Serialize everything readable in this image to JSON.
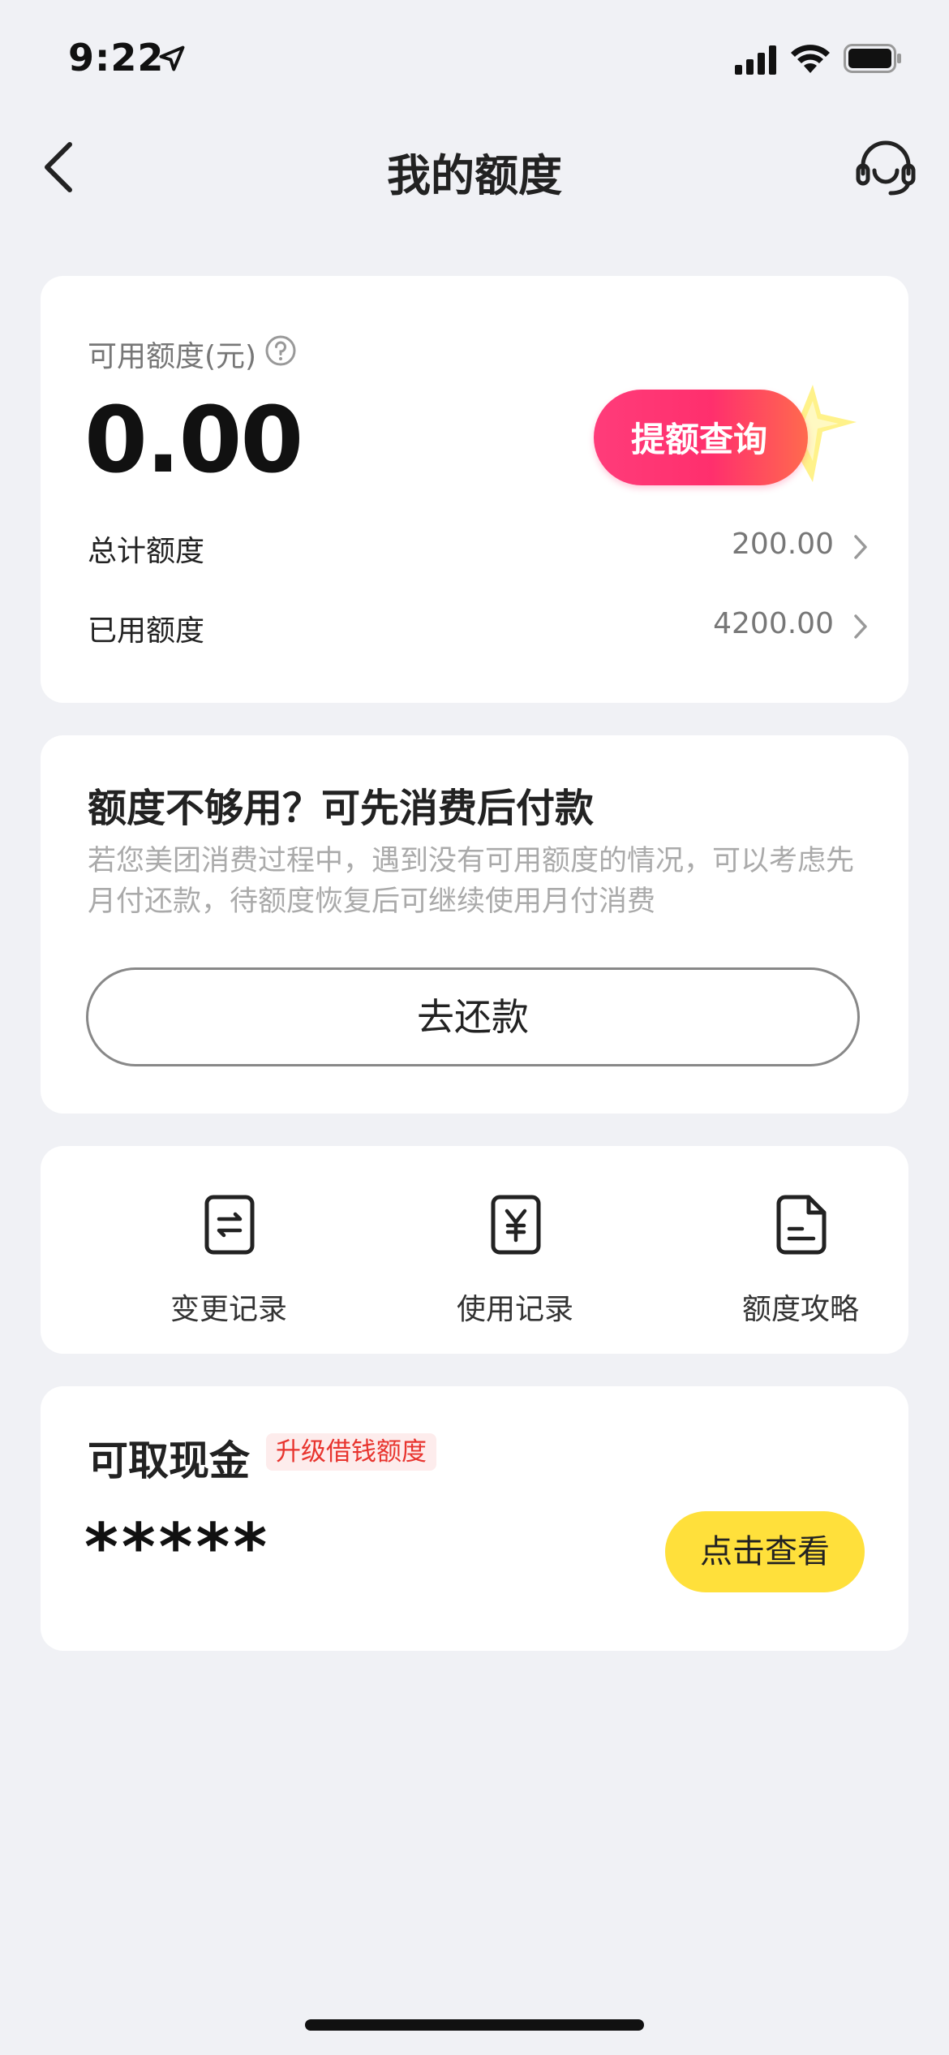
{
  "status_bar": {
    "time": "9:22",
    "icons": [
      "location-arrow-icon",
      "signal-icon",
      "wifi-icon",
      "battery-icon"
    ]
  },
  "nav": {
    "title": "我的额度",
    "left_icon": "chevron-left-icon",
    "right_icon": "headset-icon"
  },
  "limit_card": {
    "available_label": "可用额度(元)",
    "available_amount": "0.00",
    "raise_button": "提额查询",
    "rows": [
      {
        "label": "总计额度",
        "value": "200.00"
      },
      {
        "label": "已用额度",
        "value": "4200.00"
      }
    ]
  },
  "pay_later_card": {
    "title": "额度不够用？可先消费后付款",
    "description": "若您美团消费过程中，遇到没有可用额度的情况，可以考虑先月付还款，待额度恢复后可继续使用月付消费",
    "button": "去还款"
  },
  "shortcuts": [
    {
      "label": "变更记录",
      "icon": "exchange-document-icon"
    },
    {
      "label": "使用记录",
      "icon": "yuan-document-icon"
    },
    {
      "label": "额度攻略",
      "icon": "guide-document-icon"
    }
  ],
  "cash_card": {
    "title": "可取现金",
    "tag": "升级借钱额度",
    "masked_value": "*****",
    "button": "点击查看"
  },
  "colors": {
    "background": "#f0f1f5",
    "accent_yellow": "#ffe03b",
    "raise_pink": "#ff2f6d",
    "tag_red": "#e8342e"
  }
}
